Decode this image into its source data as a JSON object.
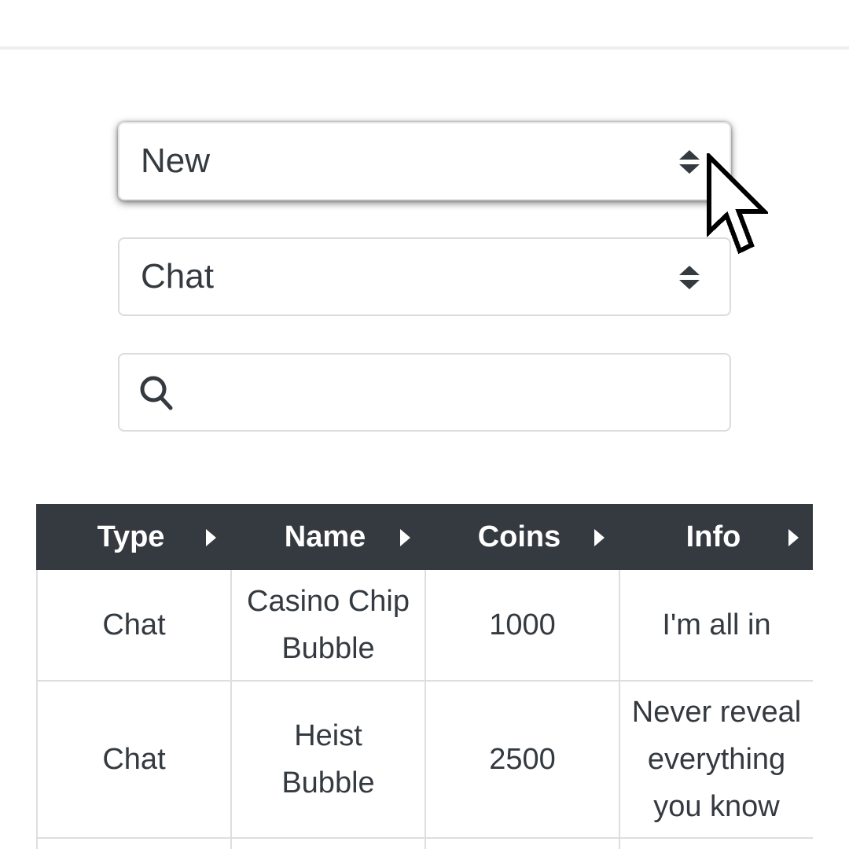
{
  "filters": {
    "sort_select": {
      "value": "New"
    },
    "type_select": {
      "value": "Chat"
    },
    "search": {
      "value": "",
      "placeholder": ""
    }
  },
  "table": {
    "columns": [
      "Type",
      "Name",
      "Coins",
      "Info"
    ],
    "rows": [
      {
        "type": "Chat",
        "name": "Casino Chip Bubble",
        "coins": "1000",
        "info": "I'm all in"
      },
      {
        "type": "Chat",
        "name": "Heist Bubble",
        "coins": "2500",
        "info": "Never reveal everything you know"
      }
    ]
  },
  "icons": {
    "select_caret": "sort-caret-icon",
    "search": "search-icon",
    "sort_arrow": "caret-right-icon",
    "pointer": "mouse-pointer-icon"
  },
  "colors": {
    "header_bg": "#343a40",
    "header_text": "#ffffff",
    "text": "#343a40",
    "border": "#dedede"
  }
}
